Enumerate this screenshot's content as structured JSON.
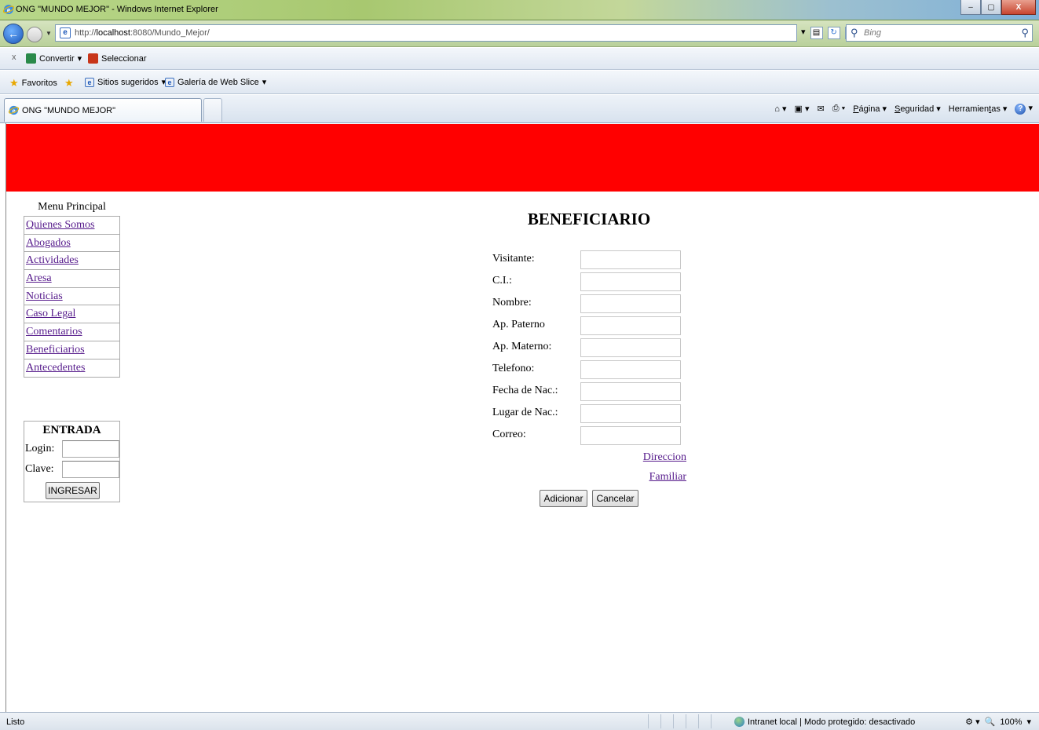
{
  "window": {
    "title": "ONG \"MUNDO MEJOR\" - Windows Internet Explorer",
    "minimize": "–",
    "maximize": "▢",
    "close": "X"
  },
  "address_bar": {
    "url_prefix": "http://",
    "url_host": "localhost",
    "url_rest": ":8080/Mundo_Mejor/",
    "search_placeholder": "Bing"
  },
  "command_bar": {
    "close": "x",
    "convert_label": "Convertir",
    "select_label": "Seleccionar"
  },
  "favorites_bar": {
    "favorites_label": "Favoritos",
    "suggested_sites": "Sitios sugeridos",
    "web_slice": "Galería de Web Slice"
  },
  "tab": {
    "label": "ONG \"MUNDO MEJOR\""
  },
  "tab_tools": {
    "page": "Página",
    "page_underline": "P",
    "page_rest": "ágina",
    "security_underline": "S",
    "security_rest": "eguridad",
    "tools_a": "Herramien",
    "tools_u": "t",
    "tools_b": "as"
  },
  "sidebar": {
    "menu_title": "Menu Principal",
    "items": [
      {
        "label": "Quienes Somos"
      },
      {
        "label": "Abogados"
      },
      {
        "label": "Actividades"
      },
      {
        "label": "Aresa"
      },
      {
        "label": "Noticias"
      },
      {
        "label": "Caso Legal"
      },
      {
        "label": "Comentarios"
      },
      {
        "label": "Beneficiarios"
      },
      {
        "label": "Antecedentes"
      }
    ]
  },
  "login": {
    "title": "ENTRADA",
    "login_label": "Login:",
    "password_label": "Clave:",
    "submit_label": "INGRESAR"
  },
  "form": {
    "title": "BENEFICIARIO",
    "fields": [
      {
        "label": "Visitante:",
        "value": ""
      },
      {
        "label": "C.I.:",
        "value": ""
      },
      {
        "label": "Nombre:",
        "value": ""
      },
      {
        "label": "Ap. Paterno",
        "value": ""
      },
      {
        "label": "Ap. Materno:",
        "value": ""
      },
      {
        "label": "Telefono:",
        "value": ""
      },
      {
        "label": "Fecha de Nac.:",
        "value": ""
      },
      {
        "label": "Lugar de Nac.:",
        "value": ""
      },
      {
        "label": "Correo:",
        "value": ""
      }
    ],
    "address_link": "Direccion",
    "family_link": "Familiar",
    "add_button": "Adicionar",
    "cancel_button": "Cancelar"
  },
  "status_bar": {
    "status": "Listo",
    "zone": "Intranet local | Modo protegido: desactivado",
    "zoom": "100%"
  },
  "colors": {
    "banner": "#ff0000",
    "link": "#551a8b"
  }
}
